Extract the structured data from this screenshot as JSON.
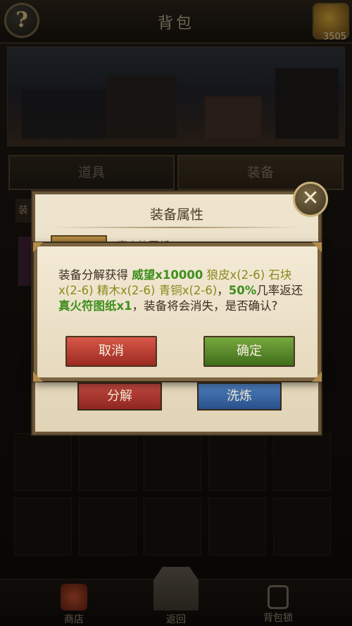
{
  "header": {
    "help_glyph": "?",
    "title": "背包",
    "bag_count": "3505"
  },
  "tabs": [
    {
      "label": "道具"
    },
    {
      "label": "装备"
    }
  ],
  "attr_panel": {
    "title": "装备属性",
    "item_name": "真火符图纸 x150",
    "sliver_label": "装",
    "decompose_label": "分解",
    "refine_label": "洗炼"
  },
  "confirm": {
    "msg_prefix": "装备分解获得 ",
    "reward_1": "威望x10000",
    "reward_2": "狼皮x(2-6)",
    "reward_3": "石块x(2-6)",
    "reward_4": "精木x(2-6)",
    "reward_5": "青铜x(2-6)",
    "chance": "50%",
    "msg_mid": "几率返还",
    "reward_6": "真火符图纸x1",
    "msg_suffix": "，装备将会消失，是否确认?",
    "cancel_label": "取消",
    "ok_label": "确定"
  },
  "bottom_nav": {
    "shop_label": "商店",
    "back_label": "返回",
    "lock_label": "背包锁"
  },
  "colors": {
    "green_text": "#3f8f1e",
    "olive_text": "#8a8a1c",
    "cancel_red": "#b0382e",
    "ok_green": "#5b8a2c"
  }
}
